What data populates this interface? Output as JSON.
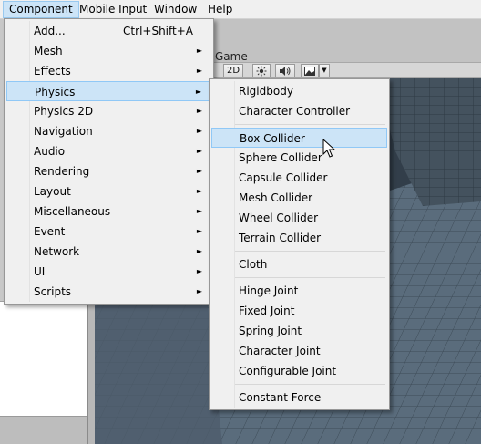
{
  "menubar": {
    "items": [
      "Component",
      "Mobile Input",
      "Window",
      "Help"
    ]
  },
  "game_view": {
    "tab_label": "Game",
    "toolbar": {
      "mode_label": "2D",
      "sun_icon": "sun-icon",
      "audio_icon": "speaker-icon",
      "image_icon": "image-icon",
      "dropdown_icon": "dropdown-arrow-icon"
    }
  },
  "component_menu": {
    "items": [
      {
        "label": "Add...",
        "shortcut": "Ctrl+Shift+A",
        "has_submenu": false
      },
      {
        "label": "Mesh",
        "has_submenu": true
      },
      {
        "label": "Effects",
        "has_submenu": true
      },
      {
        "label": "Physics",
        "has_submenu": true,
        "highlighted": true
      },
      {
        "label": "Physics 2D",
        "has_submenu": true
      },
      {
        "label": "Navigation",
        "has_submenu": true
      },
      {
        "label": "Audio",
        "has_submenu": true
      },
      {
        "label": "Rendering",
        "has_submenu": true
      },
      {
        "label": "Layout",
        "has_submenu": true
      },
      {
        "label": "Miscellaneous",
        "has_submenu": true
      },
      {
        "label": "Event",
        "has_submenu": true
      },
      {
        "label": "Network",
        "has_submenu": true
      },
      {
        "label": "UI",
        "has_submenu": true
      },
      {
        "label": "Scripts",
        "has_submenu": true
      }
    ],
    "arrow_glyph": "►"
  },
  "physics_menu": {
    "groups": [
      [
        "Rigidbody",
        "Character Controller"
      ],
      [
        "Box Collider",
        "Sphere Collider",
        "Capsule Collider",
        "Mesh Collider",
        "Wheel Collider",
        "Terrain Collider"
      ],
      [
        "Cloth"
      ],
      [
        "Hinge Joint",
        "Fixed Joint",
        "Spring Joint",
        "Character Joint",
        "Configurable Joint"
      ],
      [
        "Constant Force"
      ]
    ],
    "highlighted": "Box Collider"
  },
  "colors": {
    "menu_bg": "#f0f0f0",
    "highlight_bg": "#cce4f7",
    "highlight_border": "#90c8f6",
    "viewport_sky": "#323e4a",
    "viewport_floor": "#5a6c7c"
  }
}
